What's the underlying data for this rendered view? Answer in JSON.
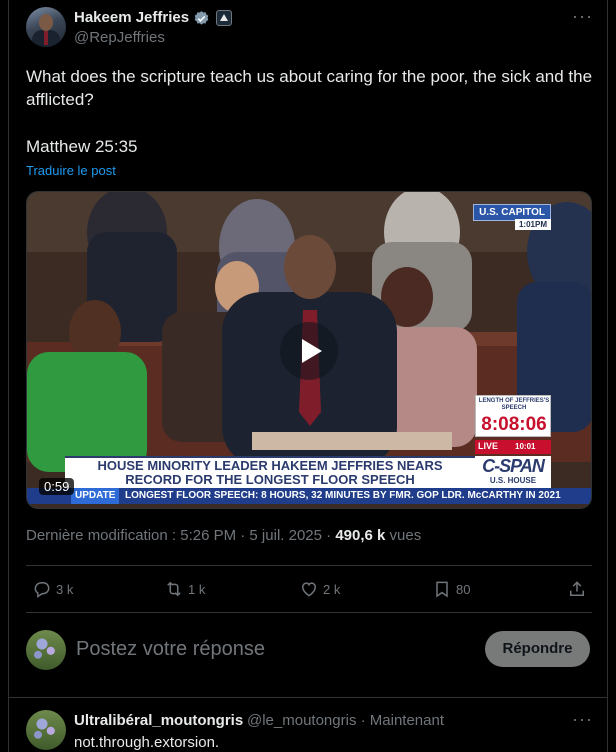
{
  "post": {
    "author_name": "Hakeem Jeffries",
    "author_handle": "@RepJeffries",
    "text": "What does the scripture teach us about caring for the poor, the sick and the afflicted?",
    "reference": "Matthew 25:35",
    "translate_label": "Traduire le post",
    "video": {
      "duration": "0:59",
      "capitol_badge": "U.S. CAPITOL",
      "capitol_time": "1:01PM",
      "length_label": "LENGTH OF JEFFRIES'S SPEECH",
      "length_value": "8:08:06",
      "live_label": "LIVE",
      "live_time": "10:01",
      "network": "C-SPAN",
      "network_sub": "U.S. HOUSE",
      "headline_line1": "HOUSE MINORITY LEADER HAKEEM JEFFRIES NEARS",
      "headline_line2": "RECORD FOR THE LONGEST FLOOR SPEECH",
      "ticker_tag": "UPDATE",
      "ticker_text": "LONGEST FLOOR SPEECH: 8 HOURS, 32 MINUTES BY FMR. GOP LDR. McCARTHY IN 2021"
    },
    "meta_prefix": "Dernière modification : 5:26 PM · 5 juil. 2025 · ",
    "views_count": "490,6 k",
    "views_label": " vues"
  },
  "actions": {
    "replies": "3 k",
    "reposts": "1 k",
    "likes": "2 k",
    "bookmarks": "80"
  },
  "composer": {
    "placeholder": "Postez votre réponse",
    "reply_button": "Répondre"
  },
  "comment": {
    "name": "Ultralibéral_moutongris",
    "meta": "@le_moutongris · Maintenant",
    "text": "not.through.extorsion."
  },
  "colors": {
    "accent": "#1d9bf0",
    "muted": "#71767b",
    "text": "#e7e9ea",
    "background": "#000000"
  },
  "icons": [
    "verified-icon",
    "government-badge-icon",
    "more-icon",
    "play-icon",
    "reply-icon",
    "repost-icon",
    "like-icon",
    "bookmark-icon",
    "share-icon"
  ]
}
